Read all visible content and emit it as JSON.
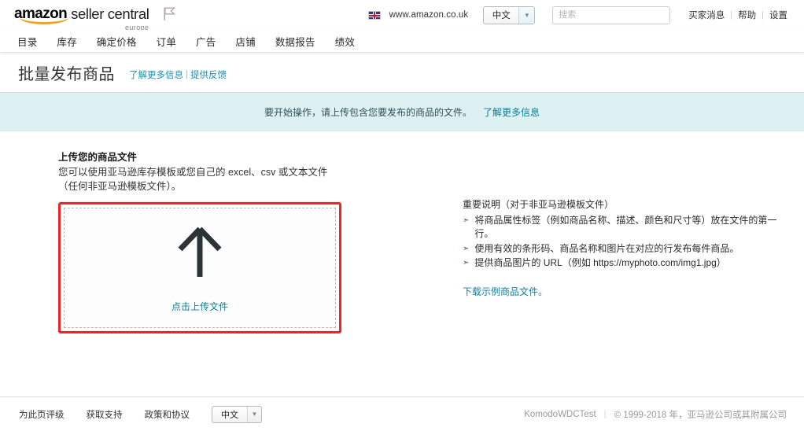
{
  "header": {
    "logo": {
      "amazon": "amazon",
      "seller_central": "seller central",
      "region": "europe",
      "pennant_icon": "pennant-flag-icon"
    },
    "marketplace_flag": "uk-flag-icon",
    "domain": "www.amazon.co.uk",
    "language": {
      "value": "中文",
      "chevron": "chevron-down-icon"
    },
    "search": {
      "placeholder": "搜索",
      "value": "",
      "icon": "search-icon"
    },
    "links": [
      {
        "label": "买家消息"
      },
      {
        "label": "帮助"
      },
      {
        "label": "设置"
      }
    ],
    "separator": "|"
  },
  "nav": {
    "items": [
      {
        "label": "目录"
      },
      {
        "label": "库存"
      },
      {
        "label": "确定价格"
      },
      {
        "label": "订单"
      },
      {
        "label": "广告"
      },
      {
        "label": "店铺"
      },
      {
        "label": "数据报告"
      },
      {
        "label": "绩效"
      }
    ]
  },
  "page": {
    "title": "批量发布商品",
    "learn_more": "了解更多信息",
    "divider": "|",
    "feedback": "提供反馈"
  },
  "banner": {
    "text": "要开始操作，请上传包含您要发布的商品的文件。",
    "link": "了解更多信息",
    "background_color": "#ddf0f2"
  },
  "upload": {
    "heading": "上传您的商品文件",
    "description": "您可以使用亚马逊库存模板或您自己的 excel、csv 或文本文件（任何非亚马逊模板文件）。",
    "dropzone": {
      "arrow_icon": "upload-arrow-icon",
      "link": "点击上传文件",
      "highlight_color": "#ef2424"
    }
  },
  "instructions": {
    "title": "重要说明（对于非亚马逊模板文件）",
    "bullets": [
      "将商品属性标签（例如商品名称、描述、颜色和尺寸等）放在文件的第一行。",
      "使用有效的条形码、商品名称和图片在对应的行发布每件商品。",
      "提供商品图片的 URL（例如 https://myphoto.com/img1.jpg）"
    ],
    "bullet_glyph": "➣",
    "sample_link": "下载示例商品文件。"
  },
  "footer": {
    "links": [
      {
        "label": "为此页评级"
      },
      {
        "label": "获取支持"
      },
      {
        "label": "政策和协议"
      }
    ],
    "language": {
      "value": "中文",
      "chevron": "chevron-down-icon"
    },
    "account": "KomodoWDCTest",
    "separator": "|",
    "copyright": "© 1999-2018 年，亚马逊公司或其附属公司"
  }
}
